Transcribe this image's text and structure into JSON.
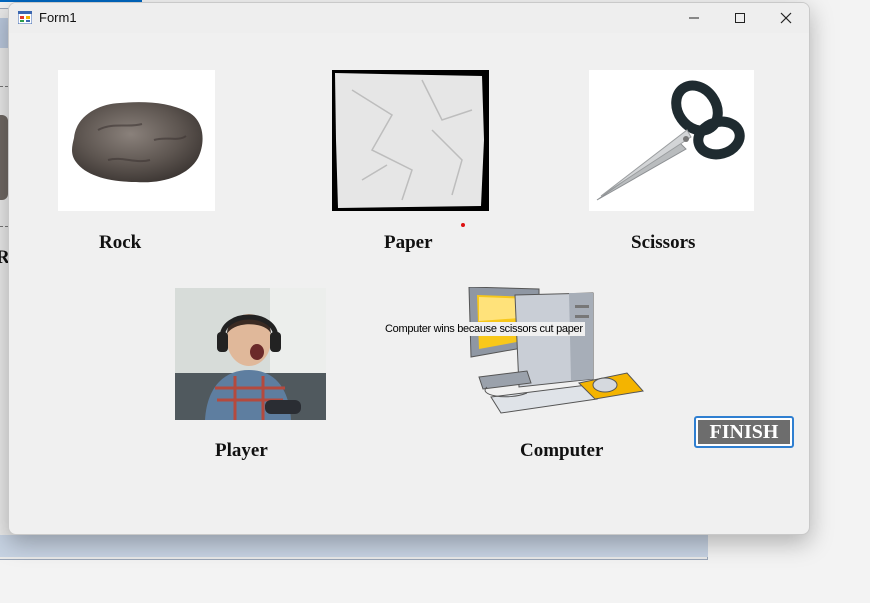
{
  "window": {
    "title": "Form1",
    "controls": {
      "minimize": "minimize-icon",
      "maximize": "maximize-icon",
      "close": "close-icon"
    }
  },
  "choices": [
    {
      "label": "Rock",
      "icon": "rock-image"
    },
    {
      "label": "Paper",
      "icon": "paper-image"
    },
    {
      "label": "Scissors",
      "icon": "scissors-image"
    }
  ],
  "player": {
    "label": "Player",
    "icon": "player-photo"
  },
  "computer": {
    "label": "Computer",
    "icon": "computer-image"
  },
  "result": {
    "text": "Computer wins because scissors cut paper"
  },
  "finish_button": {
    "label": "FINISH"
  },
  "background_window": {
    "partial_text": "R"
  },
  "colors": {
    "form_bg": "#f0f0f0",
    "finish_bg": "#6d6d6d",
    "finish_border": "#2f7fd1",
    "accent": "#0067c0"
  }
}
